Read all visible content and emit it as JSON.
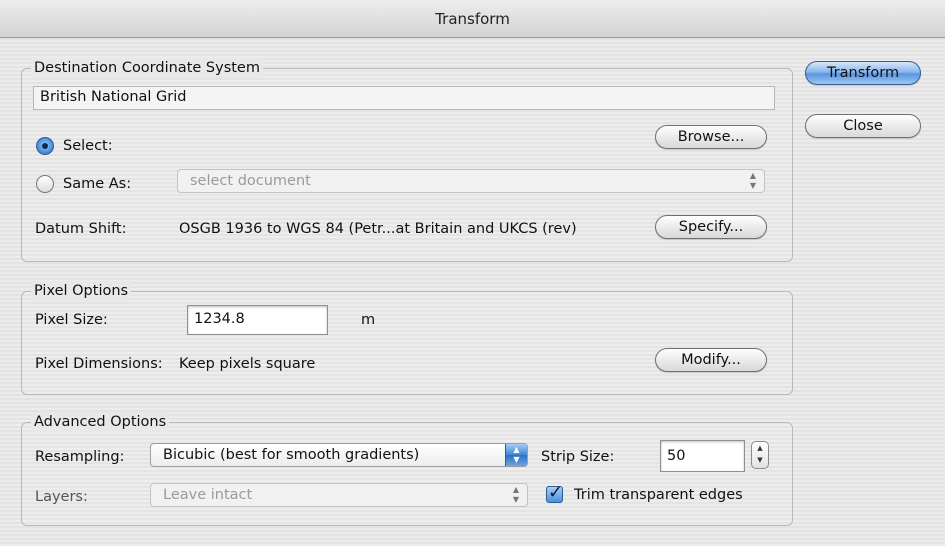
{
  "window": {
    "title": "Transform"
  },
  "buttons": {
    "transform": "Transform",
    "close": "Close",
    "browse": "Browse...",
    "specify": "Specify...",
    "modify": "Modify..."
  },
  "destination": {
    "legend": "Destination Coordinate System",
    "system_name": "British National Grid",
    "select_label": "Select:",
    "select_checked": true,
    "same_as_label": "Same As:",
    "same_as_checked": false,
    "same_as_value": "select document",
    "datum_label": "Datum Shift:",
    "datum_value": "OSGB 1936 to WGS 84 (Petr...at Britain and UKCS (rev)"
  },
  "pixel": {
    "legend": "Pixel Options",
    "size_label": "Pixel Size:",
    "size_value": "1234.8",
    "size_unit": "m",
    "dimensions_label": "Pixel Dimensions:",
    "dimensions_value": "Keep pixels square"
  },
  "advanced": {
    "legend": "Advanced Options",
    "resampling_label": "Resampling:",
    "resampling_value": "Bicubic (best for smooth gradients)",
    "strip_label": "Strip Size:",
    "strip_value": "50",
    "layers_label": "Layers:",
    "layers_value": "Leave intact",
    "trim_label": "Trim transparent edges",
    "trim_checked": true
  },
  "colors": {
    "accent": "#5a97df",
    "disabled_text": "#9a9a9a"
  }
}
